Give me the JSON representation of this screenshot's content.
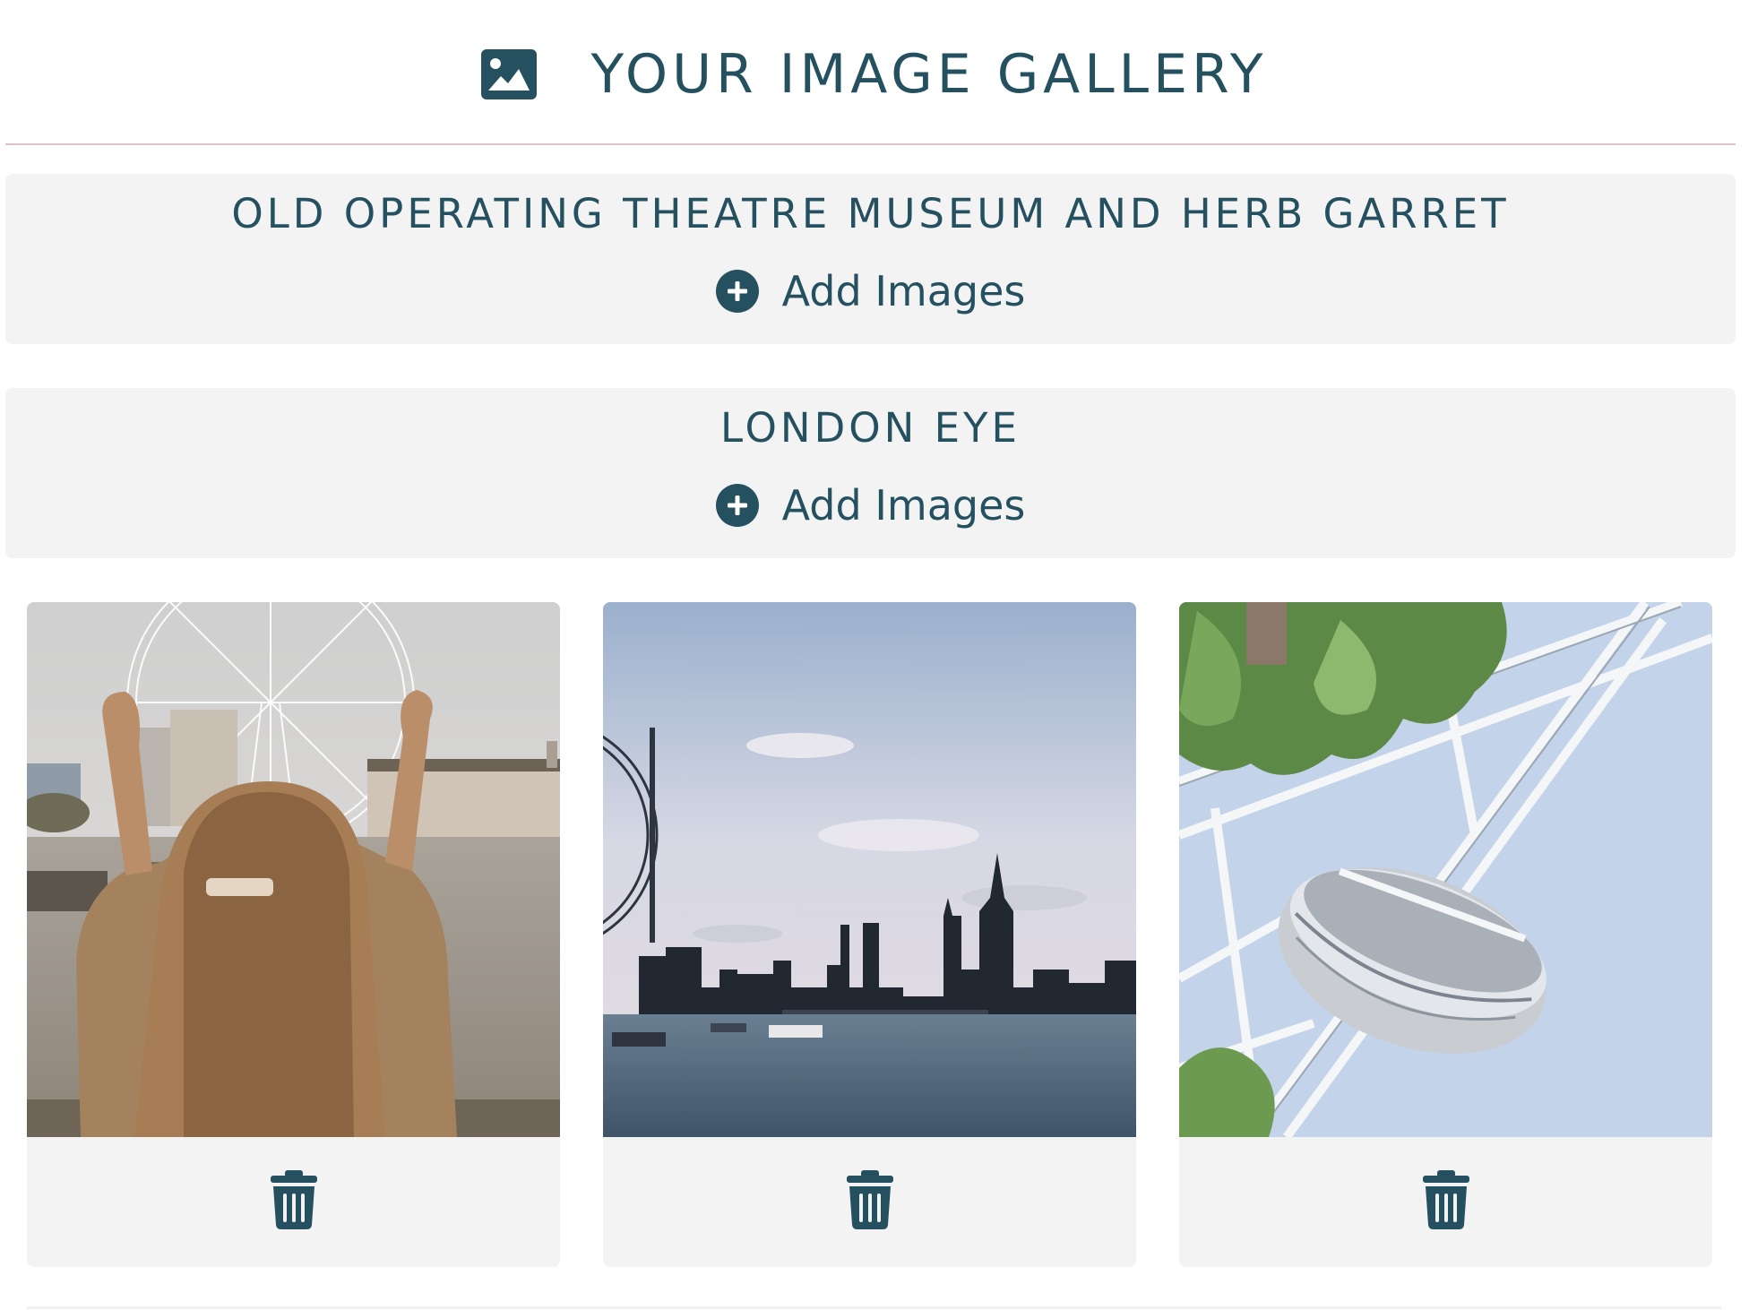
{
  "header": {
    "title": "YOUR IMAGE GALLERY",
    "icon": "image-icon"
  },
  "colors": {
    "accent": "#24505f",
    "panel": "#f3f3f3",
    "divider": "#d9c2c9"
  },
  "sections": [
    {
      "title": "OLD OPERATING THEATRE MUSEUM AND HERB GARRET",
      "add_label": "Add Images",
      "add_icon": "plus-circle-icon"
    },
    {
      "title": "LONDON EYE",
      "add_label": "Add Images",
      "add_icon": "plus-circle-icon"
    }
  ],
  "gallery": [
    {
      "photo": "woman-holding-hands-up-in-front-of-london-eye",
      "delete_icon": "trash-icon"
    },
    {
      "photo": "river-thames-skyline-with-london-eye",
      "delete_icon": "trash-icon"
    },
    {
      "photo": "london-eye-capsule-under-blue-sky",
      "delete_icon": "trash-icon"
    }
  ]
}
